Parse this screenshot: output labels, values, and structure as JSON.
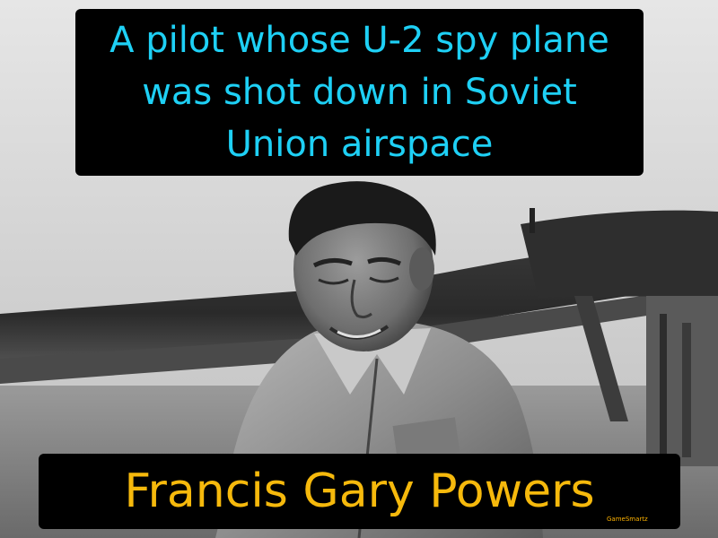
{
  "slide": {
    "definition": "A pilot whose U-2 spy plane was shot down in Soviet Union airspace",
    "term": "Francis Gary Powers",
    "brand": "GameSmartz"
  },
  "colors": {
    "definition_text": "#1ed0f5",
    "term_text": "#f6b90c",
    "box_background": "#000000"
  }
}
